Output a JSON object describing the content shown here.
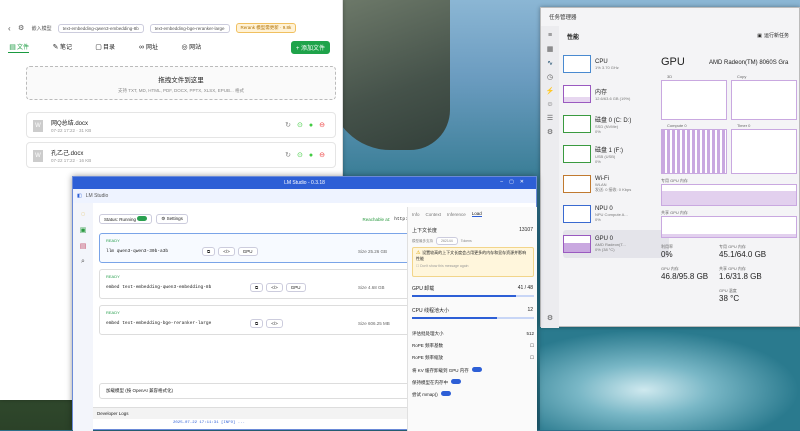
{
  "desktop": {
    "colors": {
      "sky": "#6fa0c4",
      "rock": "#4f5b52",
      "sea": "#1f6d86",
      "foam": "#d8eef2"
    }
  },
  "kb": {
    "toolbar": {
      "back": "‹",
      "settings_label": "嵌入模型",
      "model1": "text-embedding-qwen3-embedding-8b",
      "model2": "text-embedding-bge-reranker-large",
      "badge": "Rerank 模型需更新 · 9.8k"
    },
    "tabs": [
      {
        "label": "文件"
      },
      {
        "label": "笔记"
      },
      {
        "label": "目录"
      },
      {
        "label": "网址"
      },
      {
        "label": "网站"
      }
    ],
    "add_button": "+ 添加文件",
    "dropzone": {
      "title": "拖拽文件到这里",
      "subtitle": "支持 TXT, MD, HTML, PDF, DOCX, PPTX, XLSX, EPUB... 格式"
    },
    "files": [
      {
        "name": "网Q总结.docx",
        "meta": "07-22 17:22 · 31 KB"
      },
      {
        "name": "孔乙己.docx",
        "meta": "07-22 17:22 · 16 KB"
      }
    ]
  },
  "lm": {
    "title": "LM Studio - 0.3.18",
    "subtitle": "LM Studio",
    "status_label": "Status: Running",
    "settings_btn": "Settings",
    "reachable_label": "Reachable at:",
    "url": "http://192.168.1.222:1234",
    "copy": "⧉",
    "models": [
      {
        "state": "READY",
        "name": "llm  qwen3-qwen3-30b-a3b",
        "gpu": "GPU",
        "size": "Size  25.26 GB",
        "eject": "Eject"
      },
      {
        "state": "READY",
        "name": "embed  text-embedding-qwen3-embedding-8b",
        "gpu": "GPU",
        "size": "Size  4.68 GB",
        "eject": "Eject"
      },
      {
        "state": "READY",
        "name": "embed  text-embedding-bge-reranker-large",
        "gpu": "",
        "size": "Size  606.25 MB",
        "eject": "Eject"
      }
    ],
    "footer_banner": "加载模型 (按 OpenAI 兼容格式化)",
    "dev_logs": "Developer Logs",
    "log_line": "2025-07-22 17:11:31 [INFO] ...",
    "side_tabs": [
      "Info",
      "Context",
      "Inference",
      "Load"
    ],
    "context_label": "上下文长度",
    "context_value": "13107",
    "context_sub": "模型最多支持",
    "context_max": "262144",
    "context_tok": "Tokens",
    "warn_text": "设置较高的上下文长度会占用更多的内存和显存资源并影响性能",
    "warn_check": "Don't show this message again",
    "gpu_offload": "GPU 卸载",
    "gpu_offload_val": "41 / 48",
    "cpu_threads": "CPU 线程池大小",
    "cpu_threads_val": "12",
    "params": [
      {
        "label": "评估批处理大小",
        "value": "512"
      },
      {
        "label": "RoPE 频率基数",
        "value": ""
      },
      {
        "label": "RoPE 频率缩放",
        "value": ""
      },
      {
        "label": "将 KV 缓存卸载到 GPU 内存",
        "value": ""
      },
      {
        "label": "保持模型在内存中",
        "value": ""
      },
      {
        "label": "尝试 mmap()",
        "value": ""
      }
    ]
  },
  "tm": {
    "title": "任务管理器",
    "tab_label": "性能",
    "run_task": "运行新任务",
    "items": [
      {
        "name": "CPU",
        "sub": "1% 3.70 GHz"
      },
      {
        "name": "内存",
        "sub": "12.6/63.6 GB (19%)"
      },
      {
        "name": "磁盘 0 (C: D:)",
        "sub": "SSD (NVMe)",
        "val": "0%"
      },
      {
        "name": "磁盘 1 (F:)",
        "sub": "USB (USB)",
        "val": "0%"
      },
      {
        "name": "Wi-Fi",
        "sub": "WLAN",
        "val": "发送: 0 接收: 0 Kbps"
      },
      {
        "name": "NPU 0",
        "sub": "NPU Compute A...",
        "val": "0%"
      },
      {
        "name": "GPU 0",
        "sub": "AMD Radeon(T...",
        "val": "0% (38 °C)"
      }
    ],
    "gpu_title": "GPU",
    "gpu_name": "AMD Radeon(TM) 8060S Gra",
    "graph_labels": [
      "3D",
      "Copy",
      "Compute 0",
      "Timer 0"
    ],
    "graph_labels_pct": [
      "0%",
      "0%",
      "0%",
      "0%"
    ],
    "shared_label": "专用 GPU 内存",
    "dedicated_label": "共享 GPU 内存",
    "stats": [
      {
        "label": "利用率",
        "value": "0%"
      },
      {
        "label": "专用 GPU 内存",
        "value": "45.1/64.0 GB"
      },
      {
        "label": "GPU 内存",
        "value": "46.8/95.8 GB"
      },
      {
        "label": "共享 GPU 内存",
        "value": "1.6/31.8 GB"
      },
      {
        "label": "",
        "value": ""
      },
      {
        "label": "GPU 温度",
        "value": "38 °C"
      }
    ],
    "right_notes": [
      "驱动程序",
      "驱动程序",
      "DirectX",
      "物理位置",
      "硬件",
      "保留"
    ]
  }
}
